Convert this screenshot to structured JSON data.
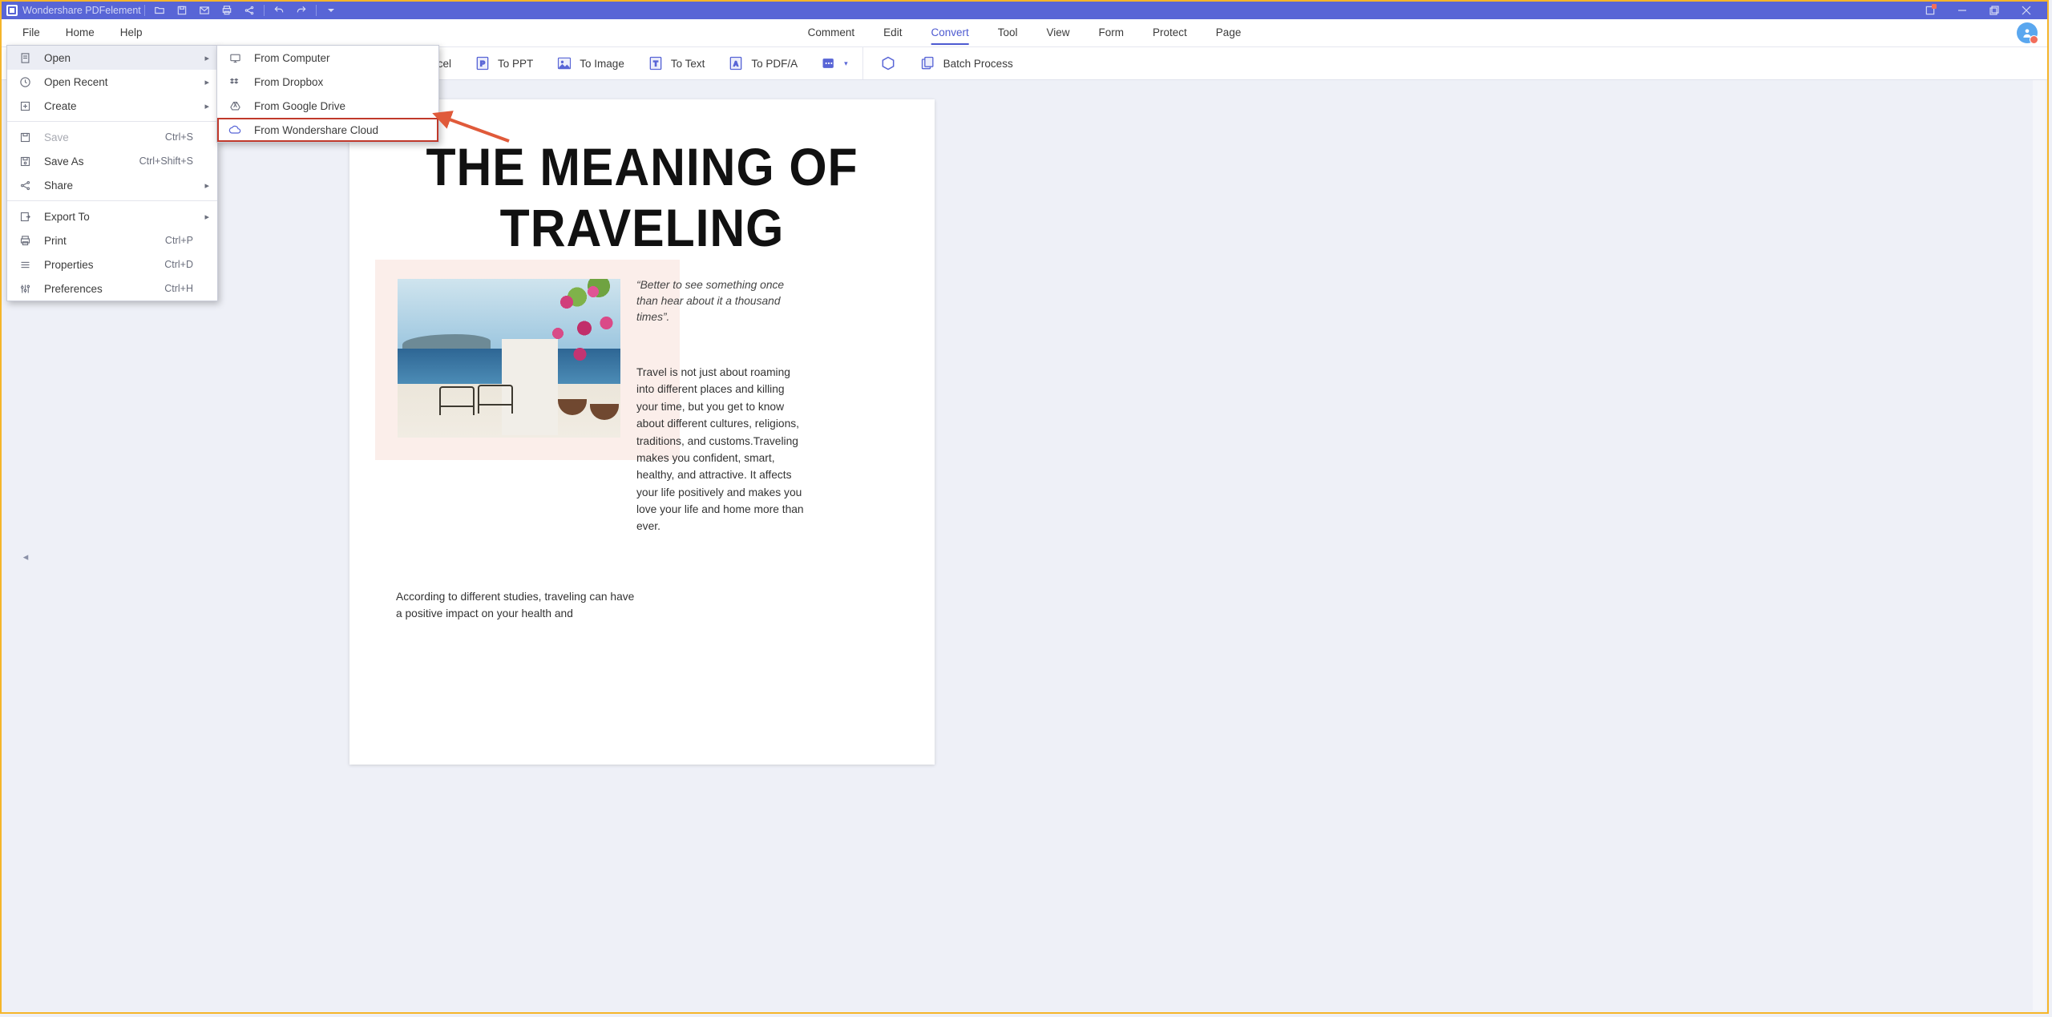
{
  "titlebar": {
    "title": "Wondershare PDFelement"
  },
  "menubar": {
    "items": [
      "File",
      "Home",
      "Help"
    ]
  },
  "tabs": {
    "items": [
      "Comment",
      "Edit",
      "Convert",
      "Tool",
      "View",
      "Form",
      "Protect",
      "Page"
    ],
    "active": "Convert"
  },
  "toolbar": {
    "to_excel": "To Excel",
    "to_ppt": "To PPT",
    "to_image": "To Image",
    "to_text": "To Text",
    "to_pdfa": "To PDF/A",
    "batch": "Batch Process"
  },
  "filemenu": [
    {
      "icon": "doc",
      "label": "Open",
      "kb": "",
      "sub": true,
      "selected": true
    },
    {
      "icon": "clock",
      "label": "Open Recent",
      "kb": "",
      "sub": true
    },
    {
      "icon": "plus",
      "label": "Create",
      "kb": "",
      "sub": true
    },
    {
      "sep": true
    },
    {
      "icon": "save",
      "label": "Save",
      "kb": "Ctrl+S",
      "disabled": true
    },
    {
      "icon": "saveas",
      "label": "Save As",
      "kb": "Ctrl+Shift+S"
    },
    {
      "icon": "share",
      "label": "Share",
      "kb": "",
      "sub": true
    },
    {
      "sep": true
    },
    {
      "icon": "export",
      "label": "Export To",
      "kb": "",
      "sub": true
    },
    {
      "icon": "print",
      "label": "Print",
      "kb": "Ctrl+P"
    },
    {
      "icon": "props",
      "label": "Properties",
      "kb": "Ctrl+D"
    },
    {
      "icon": "prefs",
      "label": "Preferences",
      "kb": "Ctrl+H"
    }
  ],
  "submenu": [
    {
      "icon": "monitor",
      "label": "From Computer"
    },
    {
      "icon": "dropbox",
      "label": "From Dropbox"
    },
    {
      "icon": "gdrive",
      "label": "From Google Drive"
    },
    {
      "icon": "cloud",
      "label": "From Wondershare Cloud",
      "highlight": true
    }
  ],
  "doc": {
    "title": "THE MEANING OF TRAVELING",
    "quote": "“Better to see something once than hear about it a thousand times”.",
    "para": "Travel is not just about roaming into different places and killing your time, but you get to know about different cultures, religions, traditions, and customs.Traveling makes you confident, smart, healthy, and attractive. It affects your life positively and makes you love your life and home more than ever.",
    "para2": "According to different studies, traveling can have a positive impact on your health and"
  }
}
